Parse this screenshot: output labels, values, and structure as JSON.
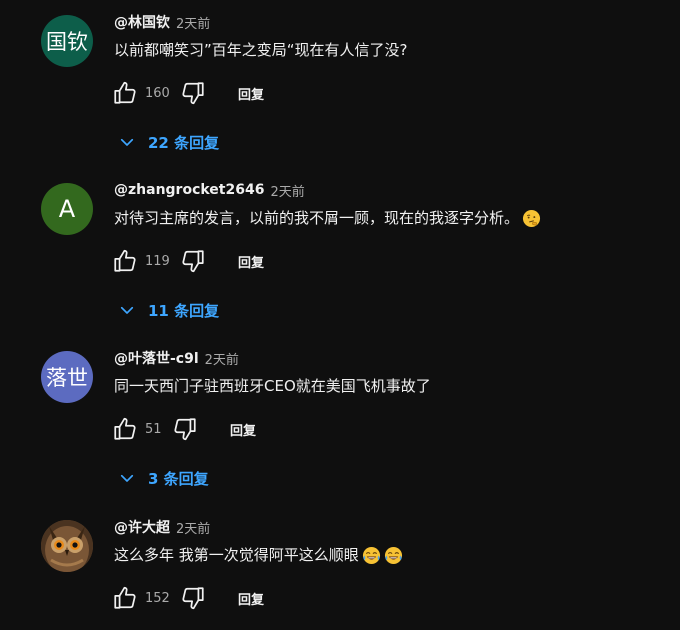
{
  "comments": [
    {
      "avatar_text": "国钦",
      "avatar_color": "#0d5e4a",
      "author": "@林国钦",
      "time": "2天前",
      "text": "以前都嘲笑习”百年之变局“现在有人信了没?",
      "likes": "160",
      "reply_label": "回复",
      "replies_label": "22 条回复"
    },
    {
      "avatar_text": "A",
      "avatar_color": "#33691e",
      "author": "@zhangrocket2646",
      "time": "2天前",
      "text": "对待习主席的发言，以前的我不屑一顾，现在的我逐字分析。",
      "likes": "119",
      "reply_label": "回复",
      "replies_label": "11 条回复"
    },
    {
      "avatar_text": "落世",
      "avatar_color": "#5c6bc0",
      "author": "@叶落世-c9l",
      "time": "2天前",
      "text": "同一天西门子驻西班牙CEO就在美国飞机事故了",
      "likes": "51",
      "reply_label": "回复",
      "replies_label": "3 条回复"
    },
    {
      "avatar_text": "",
      "avatar_color": "#6b4a2e",
      "author": "@许大超",
      "time": "2天前",
      "text": "这么多年 我第一次觉得阿平这么顺眼",
      "likes": "152",
      "reply_label": "回复"
    }
  ],
  "colors": {
    "background": "#0f0f0f",
    "link_blue": "#3ea6ff",
    "secondary_text": "#aaaaaa"
  },
  "icons": {
    "like": "thumb-up-icon",
    "dislike": "thumb-down-icon",
    "expand": "chevron-down-icon",
    "emoji_thinking": "thinking-face-emoji",
    "emoji_laughing": "tears-of-joy-emoji"
  }
}
